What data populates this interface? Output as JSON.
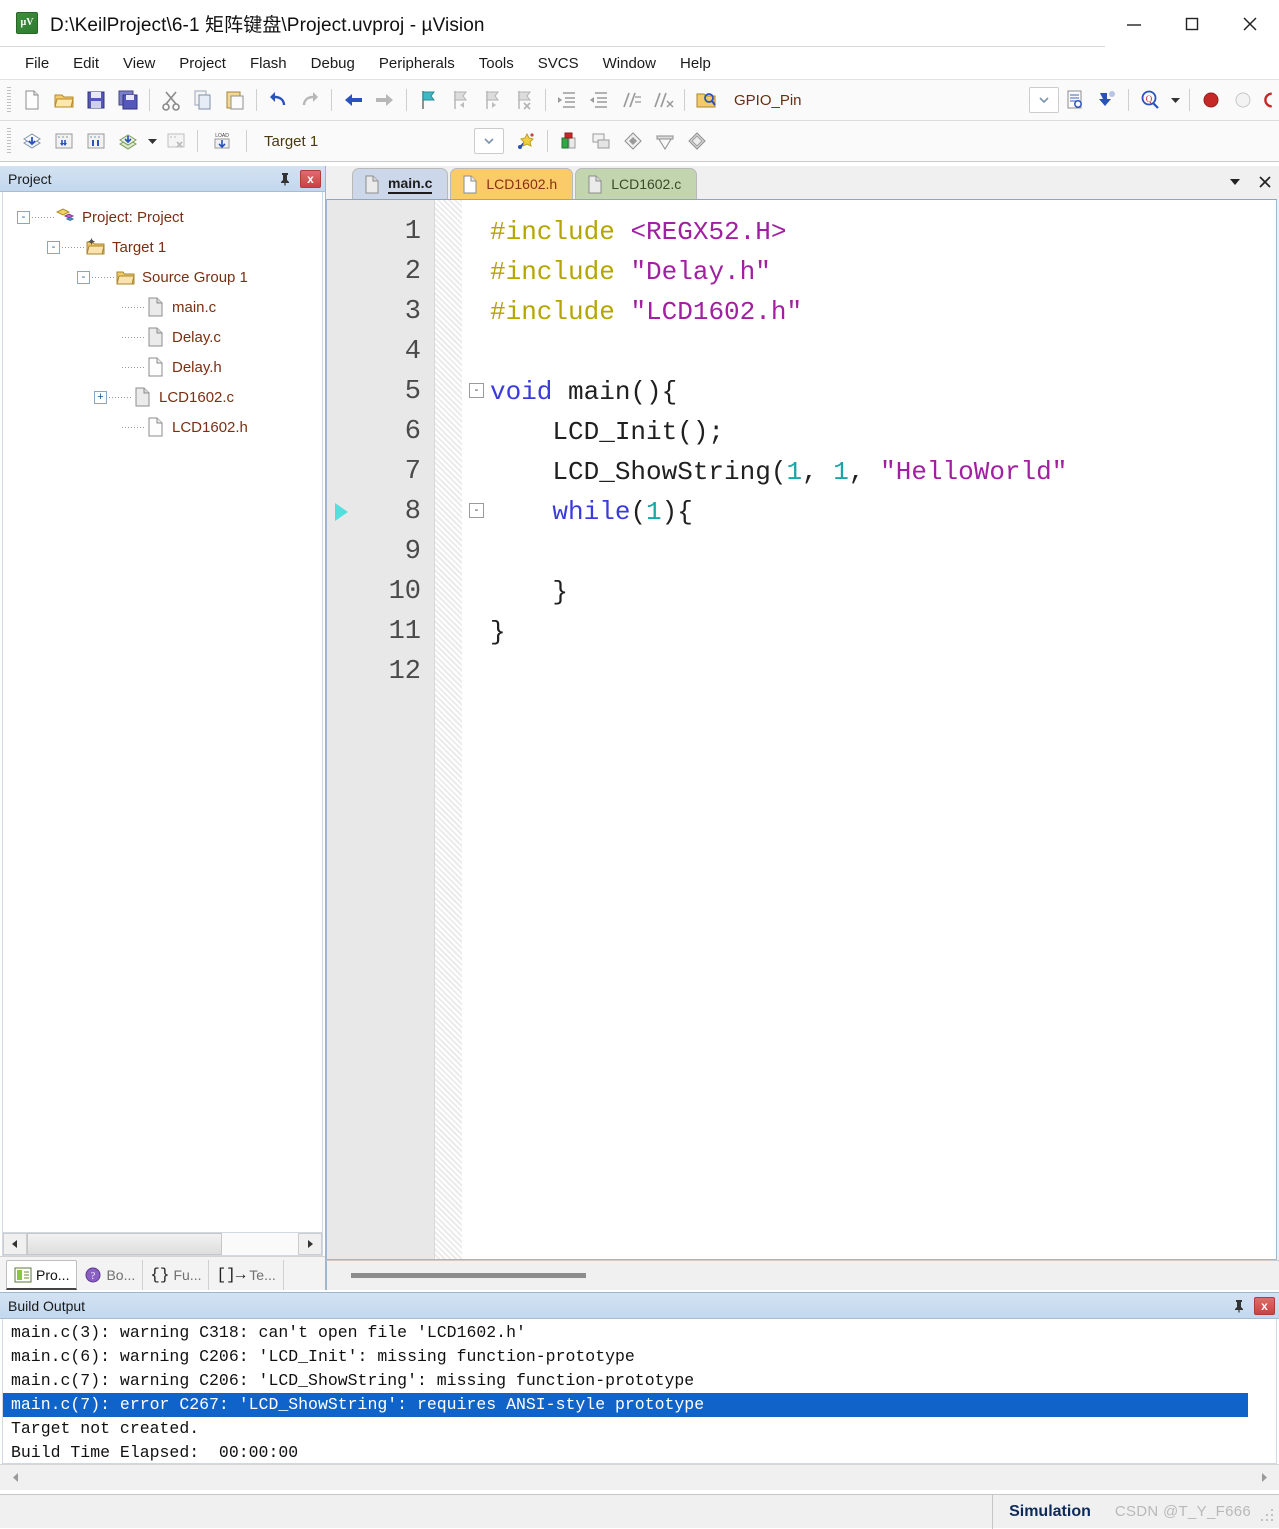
{
  "window": {
    "title": "D:\\KeilProject\\6-1 矩阵键盘\\Project.uvproj - µVision",
    "app_icon_label": "µV",
    "minimize_label": "Minimize",
    "maximize_label": "Maximize",
    "close_label": "Close"
  },
  "menubar": {
    "items": [
      {
        "label": "File"
      },
      {
        "label": "Edit"
      },
      {
        "label": "View"
      },
      {
        "label": "Project"
      },
      {
        "label": "Flash"
      },
      {
        "label": "Debug"
      },
      {
        "label": "Peripherals"
      },
      {
        "label": "Tools"
      },
      {
        "label": "SVCS"
      },
      {
        "label": "Window"
      },
      {
        "label": "Help"
      }
    ]
  },
  "toolbar_file": {
    "buttons": [
      {
        "name": "new-file-icon",
        "tooltip": "New"
      },
      {
        "name": "open-file-icon",
        "tooltip": "Open"
      },
      {
        "name": "save-icon",
        "tooltip": "Save"
      },
      {
        "name": "save-all-icon",
        "tooltip": "Save All"
      },
      {
        "name": "cut-icon",
        "tooltip": "Cut"
      },
      {
        "name": "copy-icon",
        "tooltip": "Copy"
      },
      {
        "name": "paste-icon",
        "tooltip": "Paste"
      },
      {
        "name": "undo-icon",
        "tooltip": "Undo"
      },
      {
        "name": "redo-icon",
        "tooltip": "Redo"
      },
      {
        "name": "navigate-back-icon",
        "tooltip": "Back"
      },
      {
        "name": "navigate-forward-icon",
        "tooltip": "Forward"
      },
      {
        "name": "bookmark-toggle-icon",
        "tooltip": "Insert/Remove Bookmark"
      },
      {
        "name": "bookmark-prev-icon",
        "tooltip": "Previous Bookmark"
      },
      {
        "name": "bookmark-next-icon",
        "tooltip": "Next Bookmark"
      },
      {
        "name": "bookmark-clear-icon",
        "tooltip": "Clear All Bookmarks"
      },
      {
        "name": "indent-icon",
        "tooltip": "Indent"
      },
      {
        "name": "outdent-icon",
        "tooltip": "Outdent"
      },
      {
        "name": "comment-icon",
        "tooltip": "Comment"
      },
      {
        "name": "uncomment-icon",
        "tooltip": "Uncomment"
      },
      {
        "name": "find-in-files-icon",
        "tooltip": "Find in Files"
      }
    ],
    "search_value": "GPIO_Pin",
    "search_placeholder": "",
    "right_buttons": [
      {
        "name": "browse-info-icon",
        "tooltip": "Source Browse"
      },
      {
        "name": "insert-icon",
        "tooltip": "Insert"
      },
      {
        "name": "find-icon",
        "tooltip": "Find"
      }
    ],
    "debug_buttons": [
      {
        "name": "breakpoint-insert-icon",
        "tooltip": "Insert/Remove Breakpoint"
      },
      {
        "name": "breakpoint-disable-icon",
        "tooltip": "Enable/Disable Breakpoint"
      },
      {
        "name": "breakpoint-disable-all-icon",
        "tooltip": "Disable All Breakpoints"
      }
    ]
  },
  "toolbar_build": {
    "buttons": [
      {
        "name": "translate-icon",
        "tooltip": "Translate"
      },
      {
        "name": "build-icon",
        "tooltip": "Build"
      },
      {
        "name": "rebuild-icon",
        "tooltip": "Rebuild"
      },
      {
        "name": "batch-build-icon",
        "tooltip": "Batch Build"
      },
      {
        "name": "stop-build-icon",
        "tooltip": "Stop Build"
      },
      {
        "name": "download-icon",
        "tooltip": "Download"
      }
    ],
    "target_value": "Target 1",
    "target_placeholder": "",
    "right_buttons": [
      {
        "name": "target-options-icon",
        "tooltip": "Options for Target"
      },
      {
        "name": "manage-project-icon",
        "tooltip": "Manage Project Items"
      },
      {
        "name": "multi-project-icon",
        "tooltip": "Manage Multi-Project"
      },
      {
        "name": "components-icon",
        "tooltip": "Manage Run-Time Environment"
      },
      {
        "name": "pack-installer-icon",
        "tooltip": "Pack Installer"
      }
    ]
  },
  "project_pane": {
    "title": "Project",
    "pin_tooltip": "Auto Hide",
    "close_label": "x",
    "tree": [
      {
        "indent": 0,
        "expander": "-",
        "icon": "project-icon",
        "label": "Project: Project"
      },
      {
        "indent": 1,
        "expander": "-",
        "icon": "target-icon",
        "label": "Target 1"
      },
      {
        "indent": 2,
        "expander": "-",
        "icon": "folder-icon",
        "label": "Source Group 1"
      },
      {
        "indent": 3,
        "expander": "",
        "icon": "c-file-icon",
        "label": "main.c"
      },
      {
        "indent": 3,
        "expander": "",
        "icon": "c-file-icon",
        "label": "Delay.c"
      },
      {
        "indent": 3,
        "expander": "",
        "icon": "h-file-icon",
        "label": "Delay.h"
      },
      {
        "indent": 3,
        "expander": "+",
        "icon": "c-file-icon",
        "label": "LCD1602.c"
      },
      {
        "indent": 3,
        "expander": "",
        "icon": "h-file-icon",
        "label": "LCD1602.h"
      }
    ],
    "bottom_tabs": [
      {
        "label": "Pro...",
        "icon": "project-tab-icon",
        "active": true
      },
      {
        "label": "Bo...",
        "icon": "books-tab-icon",
        "active": false
      },
      {
        "label": "Fu...",
        "icon": "functions-tab-icon",
        "active": false
      },
      {
        "label": "Te...",
        "icon": "templates-tab-icon",
        "active": false
      }
    ]
  },
  "editor": {
    "tabs": [
      {
        "label": "main.c",
        "kind": "main",
        "active": true
      },
      {
        "label": "LCD1602.h",
        "kind": "hdr",
        "active": false
      },
      {
        "label": "LCD1602.c",
        "kind": "src",
        "active": false
      }
    ],
    "tabstrip_buttons": [
      {
        "name": "tab-list-dropdown-icon",
        "glyph": "▼"
      },
      {
        "name": "close-document-icon",
        "glyph": "✕"
      }
    ],
    "lines": [
      {
        "num": "1",
        "fold": "",
        "marker": false,
        "tokens": [
          {
            "t": "#include ",
            "c": "pre"
          },
          {
            "t": "<REGX52.H>",
            "c": "str"
          }
        ]
      },
      {
        "num": "2",
        "fold": "",
        "marker": false,
        "tokens": [
          {
            "t": "#include ",
            "c": "pre"
          },
          {
            "t": "\"Delay.h\"",
            "c": "str"
          }
        ]
      },
      {
        "num": "3",
        "fold": "",
        "marker": false,
        "tokens": [
          {
            "t": "#include ",
            "c": "pre"
          },
          {
            "t": "\"LCD1602.h\"",
            "c": "str"
          }
        ]
      },
      {
        "num": "4",
        "fold": "",
        "marker": false,
        "tokens": []
      },
      {
        "num": "5",
        "fold": "-",
        "marker": false,
        "tokens": [
          {
            "t": "void",
            "c": "kw"
          },
          {
            "t": " main(){",
            "c": "pln"
          }
        ]
      },
      {
        "num": "6",
        "fold": "",
        "marker": false,
        "tokens": [
          {
            "t": "    LCD_Init();",
            "c": "pln"
          }
        ]
      },
      {
        "num": "7",
        "fold": "",
        "marker": false,
        "tokens": [
          {
            "t": "    LCD_ShowString(",
            "c": "pln"
          },
          {
            "t": "1",
            "c": "num"
          },
          {
            "t": ", ",
            "c": "pln"
          },
          {
            "t": "1",
            "c": "num"
          },
          {
            "t": ", ",
            "c": "pln"
          },
          {
            "t": "\"HelloWorld\"",
            "c": "str"
          }
        ]
      },
      {
        "num": "8",
        "fold": "-",
        "marker": true,
        "tokens": [
          {
            "t": "    ",
            "c": "pln"
          },
          {
            "t": "while",
            "c": "kw"
          },
          {
            "t": "(",
            "c": "pln"
          },
          {
            "t": "1",
            "c": "num"
          },
          {
            "t": "){",
            "c": "pln"
          }
        ]
      },
      {
        "num": "9",
        "fold": "",
        "marker": false,
        "tokens": []
      },
      {
        "num": "10",
        "fold": "",
        "marker": false,
        "tokens": [
          {
            "t": "    }",
            "c": "pln"
          }
        ]
      },
      {
        "num": "11",
        "fold": "",
        "marker": false,
        "tokens": [
          {
            "t": "}",
            "c": "pln"
          }
        ]
      },
      {
        "num": "12",
        "fold": "",
        "marker": false,
        "tokens": []
      }
    ]
  },
  "build_output": {
    "title": "Build Output",
    "pin_tooltip": "Auto Hide",
    "close_label": "x",
    "lines": [
      {
        "text": "main.c(3): warning C318: can't open file 'LCD1602.h'",
        "selected": false
      },
      {
        "text": "main.c(6): warning C206: 'LCD_Init': missing function-prototype",
        "selected": false
      },
      {
        "text": "main.c(7): warning C206: 'LCD_ShowString': missing function-prototype",
        "selected": false
      },
      {
        "text": "main.c(7): error C267: 'LCD_ShowString': requires ANSI-style prototype",
        "selected": true
      },
      {
        "text": "Target not created.",
        "selected": false
      },
      {
        "text": "Build Time Elapsed:  00:00:00",
        "selected": false
      }
    ]
  },
  "statusbar": {
    "simulation_label": "Simulation",
    "watermark": "CSDN @T_Y_F666"
  },
  "colors": {
    "accent_blue": "#1063c8",
    "tab_main": "#cdd7ea",
    "tab_header": "#fbcb6a",
    "tab_source": "#c2d5af",
    "preprocessor": "#b5a500",
    "string": "#a020a0",
    "keyword": "#3b3bdd",
    "number": "#1aa6a6",
    "pane_header": "#c3d8ee"
  }
}
